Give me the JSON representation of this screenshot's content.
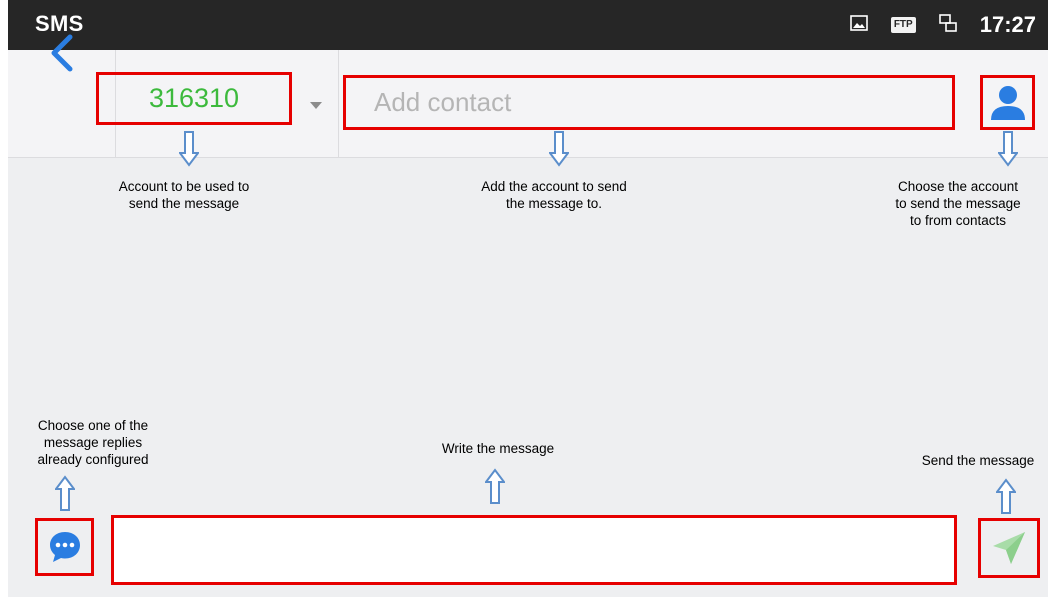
{
  "statusbar": {
    "app_title": "SMS",
    "ftp_badge": "FTP",
    "time": "17:27",
    "icons": [
      "screenshot-icon",
      "ftp-icon",
      "network-icon"
    ]
  },
  "header": {
    "account_value": "316310",
    "contact_placeholder": "Add contact",
    "back_icon": "chevron-left-icon",
    "contact_pick_icon": "person-icon",
    "dropdown_icon": "caret-down-icon"
  },
  "annotations": {
    "account": "Account to be used to\nsend the message",
    "add_contact": "Add the account to send\nthe message to.",
    "choose_contact": "Choose the account\nto send the message\nto from contacts",
    "replies": "Choose one of the\nmessage replies\nalready configured",
    "write": "Write the message",
    "send": "Send the message"
  },
  "composer": {
    "reply_icon": "chat-bubble-icon",
    "send_icon": "send-icon",
    "message_value": ""
  },
  "colors": {
    "highlight": "#e60000",
    "account_text": "#3dba3d",
    "accent_blue": "#2a7de1",
    "arrow_blue": "#5b8ecb",
    "send_green": "#a8dca8"
  }
}
